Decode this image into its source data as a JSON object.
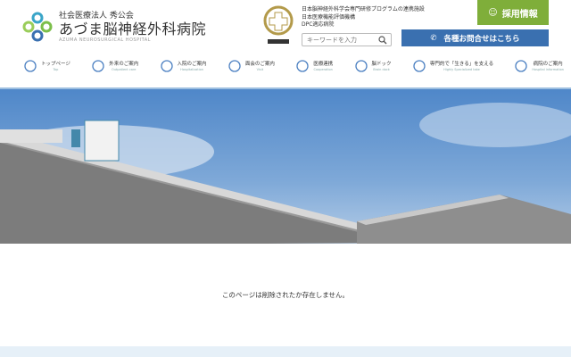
{
  "header": {
    "org": "社会医療法人 秀公会",
    "name": "あづま脳神経外科病院",
    "name_en": "AZUMA NEUROSURGICAL HOSPITAL",
    "certs": [
      "日本脳神経外科学会専門研修プログラムの連携施設",
      "日本医療機能評価機構",
      "DPC適応病院"
    ],
    "search_placeholder": "キーワードを入力",
    "recruit": "採用情報",
    "contact": "各種お問合せはこちら"
  },
  "nav": [
    {
      "jp": "トップページ",
      "en": "Top",
      "icon": "flower-icon"
    },
    {
      "jp": "外来のご案内",
      "en": "Outpatient care",
      "icon": "stethoscope-icon"
    },
    {
      "jp": "入院のご案内",
      "en": "Hospitalization",
      "icon": "bed-icon"
    },
    {
      "jp": "面会のご案内",
      "en": "Visit",
      "icon": "visitor-icon"
    },
    {
      "jp": "医療連携",
      "en": "Cooperation",
      "icon": "buildings-icon"
    },
    {
      "jp": "脳ドック",
      "en": "Brain dock",
      "icon": "brain-icon"
    },
    {
      "jp": "専門的で「生きる」を支える",
      "en": "Highly Specialized take",
      "icon": "people-icon"
    },
    {
      "jp": "病院のご案内",
      "en": "Hospital information",
      "icon": "flower-icon"
    }
  ],
  "main": {
    "message": "このページは削除されたか存在しません。"
  },
  "colors": {
    "accent": "#3a70b0",
    "recruit": "#7fae3a"
  }
}
